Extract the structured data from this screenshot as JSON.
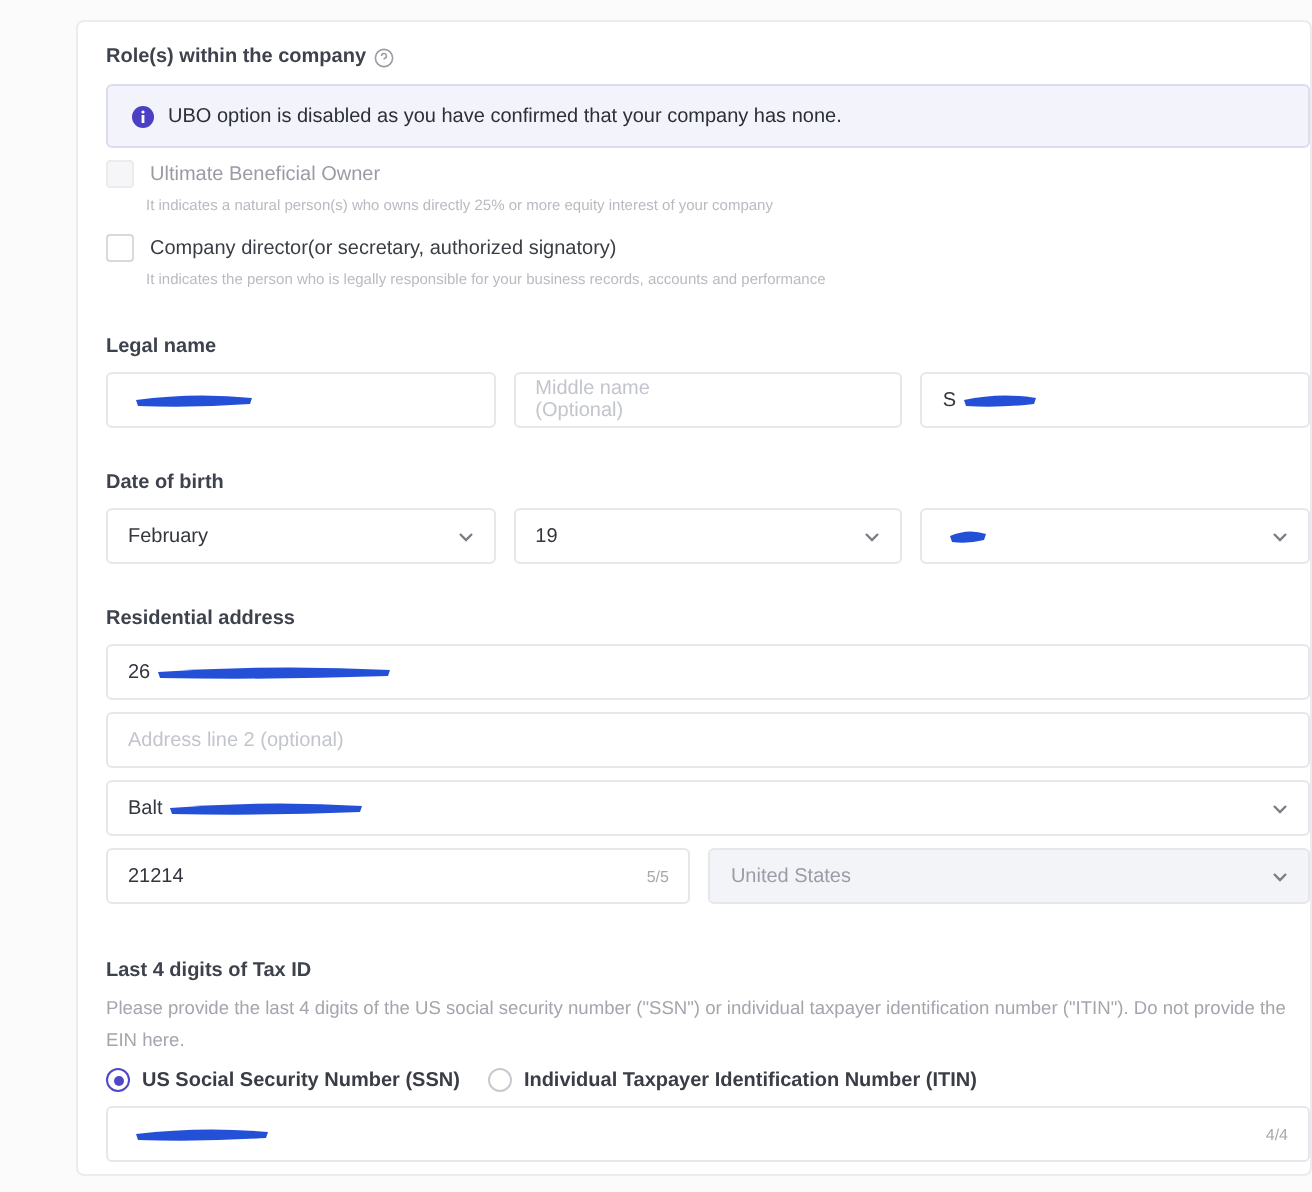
{
  "roles": {
    "label": "Role(s) within the company",
    "notice": "UBO option is disabled as you have confirmed that your company has none.",
    "options": [
      {
        "label": "Ultimate Beneficial Owner",
        "hint": "It indicates a natural person(s) who owns directly 25% or more equity interest of your company",
        "checked": false,
        "disabled": true
      },
      {
        "label": "Company director(or secretary, authorized signatory)",
        "hint": "It indicates the person who is legally responsible for your business records, accounts and performance",
        "checked": false,
        "disabled": false
      }
    ]
  },
  "legal_name": {
    "label": "Legal name",
    "fields": [
      {
        "redacted": true
      },
      {
        "placeholder": "Middle name (Optional)",
        "redacted": false
      },
      {
        "value": "S",
        "redacted": true
      }
    ]
  },
  "date_of_birth": {
    "label": "Date of birth",
    "selects": [
      {
        "value": "February",
        "redacted": false
      },
      {
        "value": "19",
        "redacted": false
      },
      {
        "redacted": true
      }
    ]
  },
  "address": {
    "label": "Residential address",
    "line1": {
      "value": "26",
      "redacted": true
    },
    "line2": {
      "placeholder": "Address line 2 (optional)"
    },
    "city": {
      "value": "Balt",
      "redacted": true
    },
    "zip": {
      "value": "21214",
      "counter": "5/5"
    },
    "country": {
      "value": "United States",
      "disabled": true
    }
  },
  "tax_id": {
    "label": "Last 4 digits of Tax ID",
    "description": "Please provide the last 4 digits of the US social security number (\"SSN\") or individual taxpayer identification number (\"ITIN\"). Do not provide the EIN here.",
    "types": [
      {
        "label": "US Social Security Number (SSN)",
        "selected": true
      },
      {
        "label": "Individual Taxpayer Identification Number (ITIN)",
        "selected": false
      }
    ],
    "field": {
      "redacted": true,
      "counter": "4/4"
    }
  }
}
